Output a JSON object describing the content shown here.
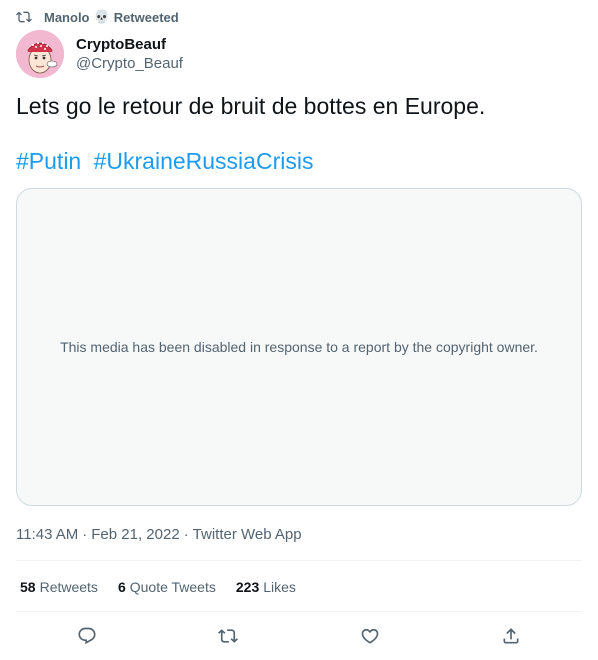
{
  "retweet_banner": {
    "user": "Manolo",
    "emoji": "💀",
    "label": "Retweeted"
  },
  "author": {
    "display_name": "CryptoBeauf",
    "handle": "@Crypto_Beauf"
  },
  "tweet": {
    "text": "Lets go le retour de bruit de bottes en Europe.",
    "hashtags": [
      "#Putin",
      "#UkraineRussiaCrisis"
    ],
    "media_notice": "This media has been disabled in response to a report by the copyright owner."
  },
  "meta": {
    "time": "11:43 AM",
    "separator": "·",
    "date": "Feb 21, 2022",
    "source": "Twitter Web App"
  },
  "stats": {
    "retweets_count": "58",
    "retweets_label": "Retweets",
    "quotes_count": "6",
    "quotes_label": "Quote Tweets",
    "likes_count": "223",
    "likes_label": "Likes"
  },
  "colors": {
    "accent": "#1d9bf0",
    "secondary_text": "#536471",
    "border": "#cfd9de"
  },
  "actions": [
    "reply-icon",
    "retweet-icon",
    "like-icon",
    "share-icon"
  ]
}
